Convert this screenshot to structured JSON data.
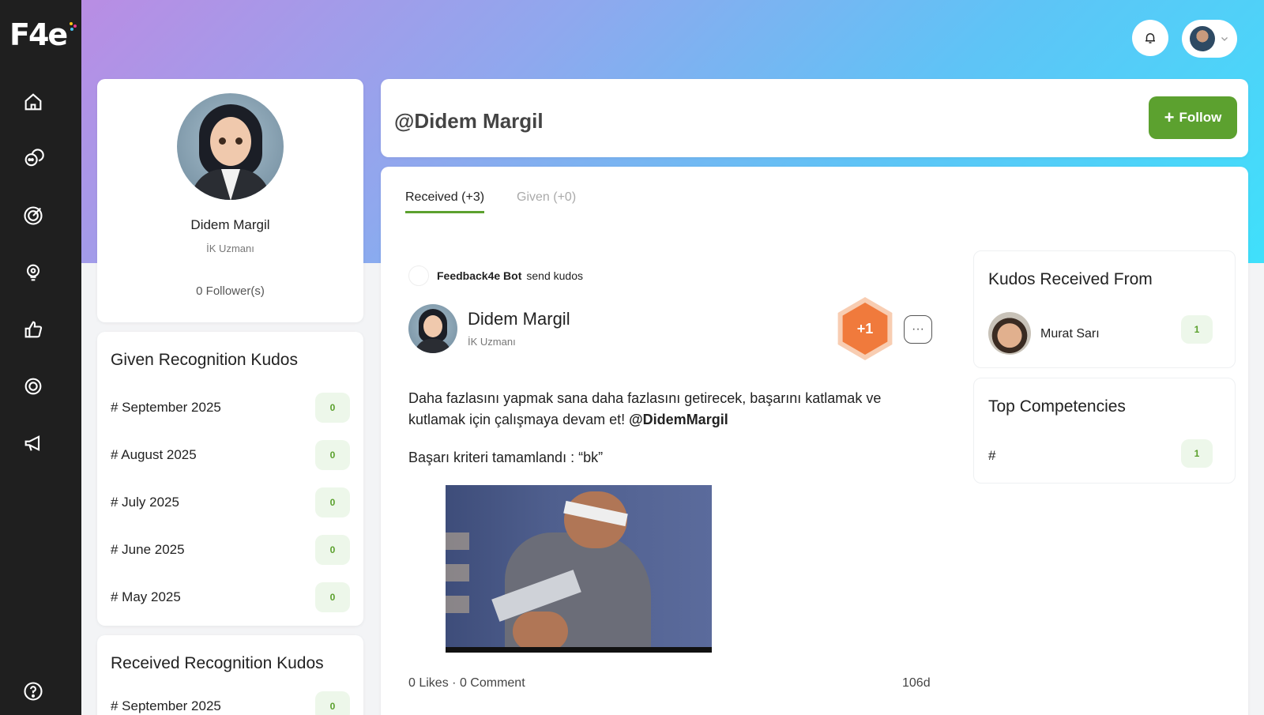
{
  "sidebar": {
    "logo": "F4e",
    "nav": [
      {
        "icon": "home-icon"
      },
      {
        "icon": "chat-icon"
      },
      {
        "icon": "target-icon"
      },
      {
        "icon": "bulb-icon"
      },
      {
        "icon": "thumbs-up-icon"
      },
      {
        "icon": "gear-icon"
      },
      {
        "icon": "megaphone-icon"
      }
    ],
    "help_icon": "help-icon"
  },
  "topbar": {
    "bell_icon": "bell-icon",
    "avatar_icon": "user-avatar",
    "chevron_icon": "chevron-down-icon"
  },
  "profile": {
    "name": "Didem Margil",
    "role": "İK Uzmanı",
    "followers": "0 Follower(s)"
  },
  "given_recognition": {
    "title": "Given Recognition Kudos",
    "rows": [
      {
        "label": "# September 2025",
        "count": "0"
      },
      {
        "label": "# August 2025",
        "count": "0"
      },
      {
        "label": "# July 2025",
        "count": "0"
      },
      {
        "label": "# June 2025",
        "count": "0"
      },
      {
        "label": "# May 2025",
        "count": "0"
      }
    ]
  },
  "received_recognition": {
    "title": "Received Recognition Kudos",
    "rows": [
      {
        "label": "# September 2025",
        "count": "0"
      }
    ]
  },
  "header": {
    "handle": "@Didem Margil",
    "follow_label": "Follow"
  },
  "tabs": {
    "received": "Received (+3)",
    "given": "Given (+0)"
  },
  "post": {
    "bot_name": "Feedback4e Bot",
    "bot_action": "send kudos",
    "author_name": "Didem Margil",
    "author_role": "İK Uzmanı",
    "points": "+1",
    "message": "Daha fazlasını yapmak sana daha fazlasını getirecek, başarını katlamak ve kutlamak için çalışmaya devam et!",
    "mention": "@DidemMargil",
    "criteria": "Başarı kriteri tamamlandı : “bk”",
    "likes": "0 Likes",
    "separator": "·",
    "comments": "0 Comment",
    "age": "106d"
  },
  "kudos_from": {
    "title": "Kudos Received From",
    "name": "Murat Sarı",
    "count": "1"
  },
  "top_competencies": {
    "title": "Top Competencies",
    "label": "#",
    "count": "1"
  }
}
